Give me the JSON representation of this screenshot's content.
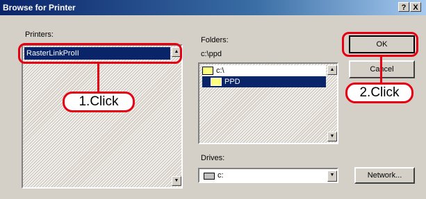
{
  "window": {
    "title": "Browse for Printer",
    "help_glyph": "?",
    "close_glyph": "X"
  },
  "printers": {
    "label": "Printers:",
    "selected": "RasterLinkProII"
  },
  "folders": {
    "label": "Folders:",
    "path": "c:\\ppd",
    "items": [
      "c:\\",
      "PPD"
    ]
  },
  "drives": {
    "label": "Drives:",
    "value": "c:"
  },
  "buttons": {
    "ok": "OK",
    "cancel": "Cancel",
    "network": "Network..."
  },
  "callouts": {
    "step1": "1.Click",
    "step2": "2.Click"
  },
  "colors": {
    "callout": "#e60012",
    "selection": "#0a246a",
    "title_bar": "#0a246a"
  }
}
